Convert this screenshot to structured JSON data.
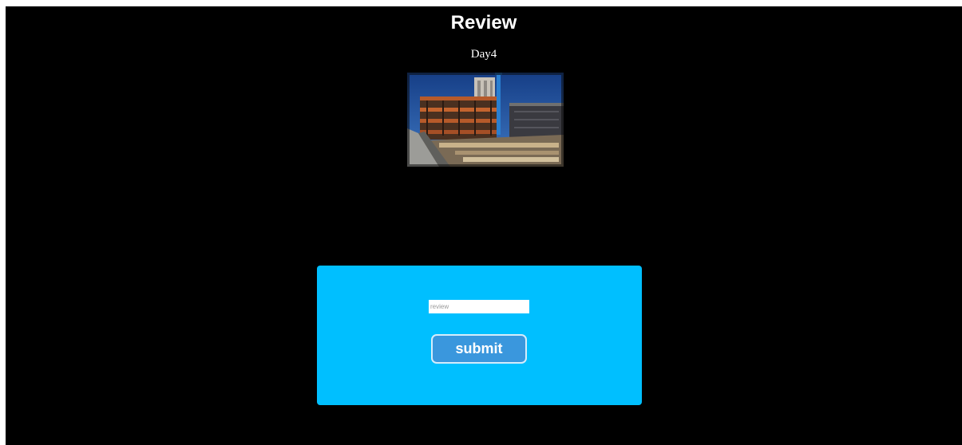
{
  "page": {
    "title": "Review",
    "subtitle": "Day4"
  },
  "photo": {
    "subject": "construction-site-photo"
  },
  "form": {
    "review_placeholder": "review",
    "review_value": "",
    "submit_label": "submit"
  },
  "colors": {
    "background": "#000000",
    "panel": "#00bfff",
    "button": "#3a97dd",
    "button_border": "#d5ecfb",
    "text": "#ffffff"
  }
}
